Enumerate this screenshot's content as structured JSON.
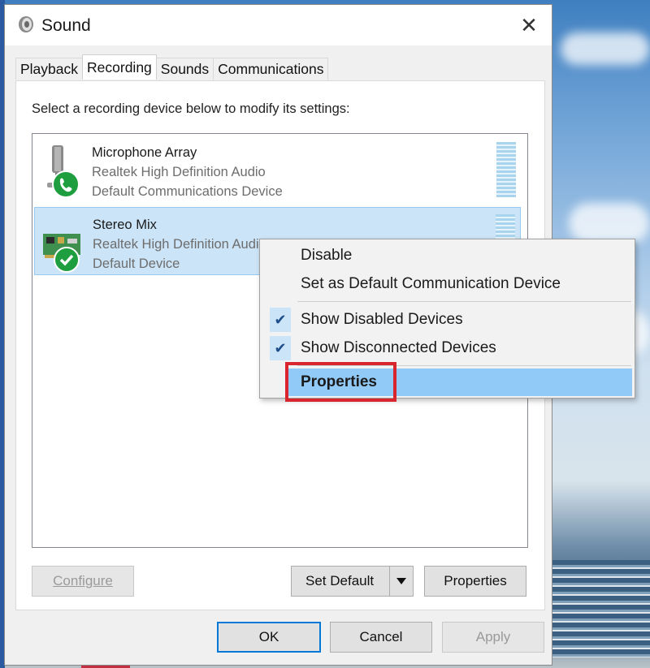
{
  "window": {
    "title": "Sound",
    "close_glyph": "✕"
  },
  "tabs": [
    {
      "label": "Playback",
      "active": false
    },
    {
      "label": "Recording",
      "active": true
    },
    {
      "label": "Sounds",
      "active": false
    },
    {
      "label": "Communications",
      "active": false
    }
  ],
  "recording": {
    "instruction": "Select a recording device below to modify its settings:",
    "devices": [
      {
        "name": "Microphone Array",
        "description": "Realtek High Definition Audio",
        "status": "Default Communications Device",
        "icon": "microphone-icon",
        "badge": "phone-badge-icon",
        "selected": false
      },
      {
        "name": "Stereo Mix",
        "description": "Realtek High Definition Audio",
        "status": "Default Device",
        "icon": "sound-card-icon",
        "badge": "check-badge-icon",
        "selected": true
      }
    ]
  },
  "buttons": {
    "configure": "Configure",
    "set_default": "Set Default",
    "properties": "Properties",
    "ok": "OK",
    "cancel": "Cancel",
    "apply": "Apply"
  },
  "context_menu": {
    "items": [
      {
        "label": "Disable",
        "checked": false
      },
      {
        "label": "Set as Default Communication Device",
        "checked": false
      },
      {
        "label": "Show Disabled Devices",
        "checked": true
      },
      {
        "label": "Show Disconnected Devices",
        "checked": true
      },
      {
        "label": "Properties",
        "checked": false,
        "highlighted": true
      }
    ]
  },
  "colors": {
    "accent": "#0078d7",
    "selection": "#cce4f7",
    "menu_highlight": "#91c9f7",
    "annotation_red": "#d9252e",
    "badge_green": "#1e9e3e"
  }
}
